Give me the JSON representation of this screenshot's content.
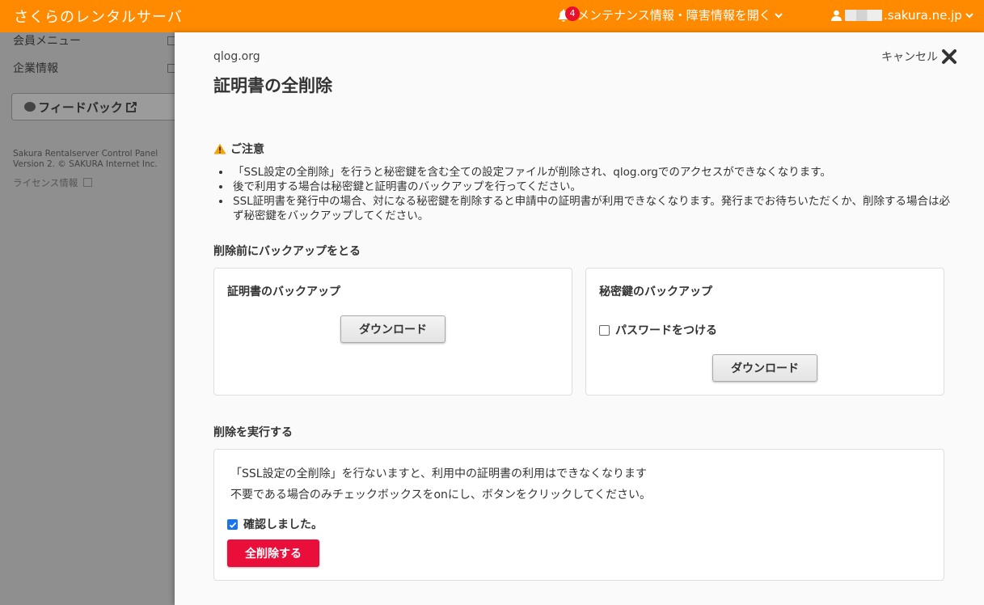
{
  "header": {
    "brand": "さくらのレンタルサーバ",
    "notification_count": "4",
    "notification_label": "メンテナンス情報・障害情報を開く",
    "account_domain": ".sakura.ne.jp",
    "accent_color": "#ff8a00"
  },
  "sidebar": {
    "items": [
      {
        "label": "会員メニュー"
      },
      {
        "label": "企業情報"
      }
    ],
    "feedback_label": "フィードバック",
    "copyright_line1": "Sakura Rentalserver Control Panel",
    "copyright_line2": "Version 2. © SAKURA Internet Inc.",
    "license_label": "ライセンス情報"
  },
  "panel": {
    "domain": "qlog.org",
    "title": "証明書の全削除",
    "cancel_label": "キャンセル",
    "caution_title": "ご注意",
    "notes": [
      "「SSL設定の全削除」を行うと秘密鍵を含む全ての設定ファイルが削除され、qlog.orgでのアクセスができなくなります。",
      "後で利用する場合は秘密鍵と証明書のバックアップを行ってください。",
      "SSL証明書を発行中の場合、対になる秘密鍵を削除すると申請中の証明書が利用できなくなります。発行までお待ちいただくか、削除する場合は必ず秘密鍵をバックアップしてください。"
    ],
    "backup_heading": "削除前にバックアップをとる",
    "cert_backup": {
      "title": "証明書のバックアップ",
      "download_label": "ダウンロード"
    },
    "key_backup": {
      "title": "秘密鍵のバックアップ",
      "password_label": "パスワードをつける",
      "password_checked": false,
      "download_label": "ダウンロード"
    },
    "execute_heading": "削除を実行する",
    "execute_text1": "「SSL設定の全削除」を行ないますと、利用中の証明書の利用はできなくなります",
    "execute_text2": "不要である場合のみチェックボックスをonにし、ボタンをクリックしてください。",
    "confirm_label": "確認しました。",
    "confirm_checked": true,
    "delete_label": "全削除する",
    "danger_color": "#ea0f3b"
  }
}
